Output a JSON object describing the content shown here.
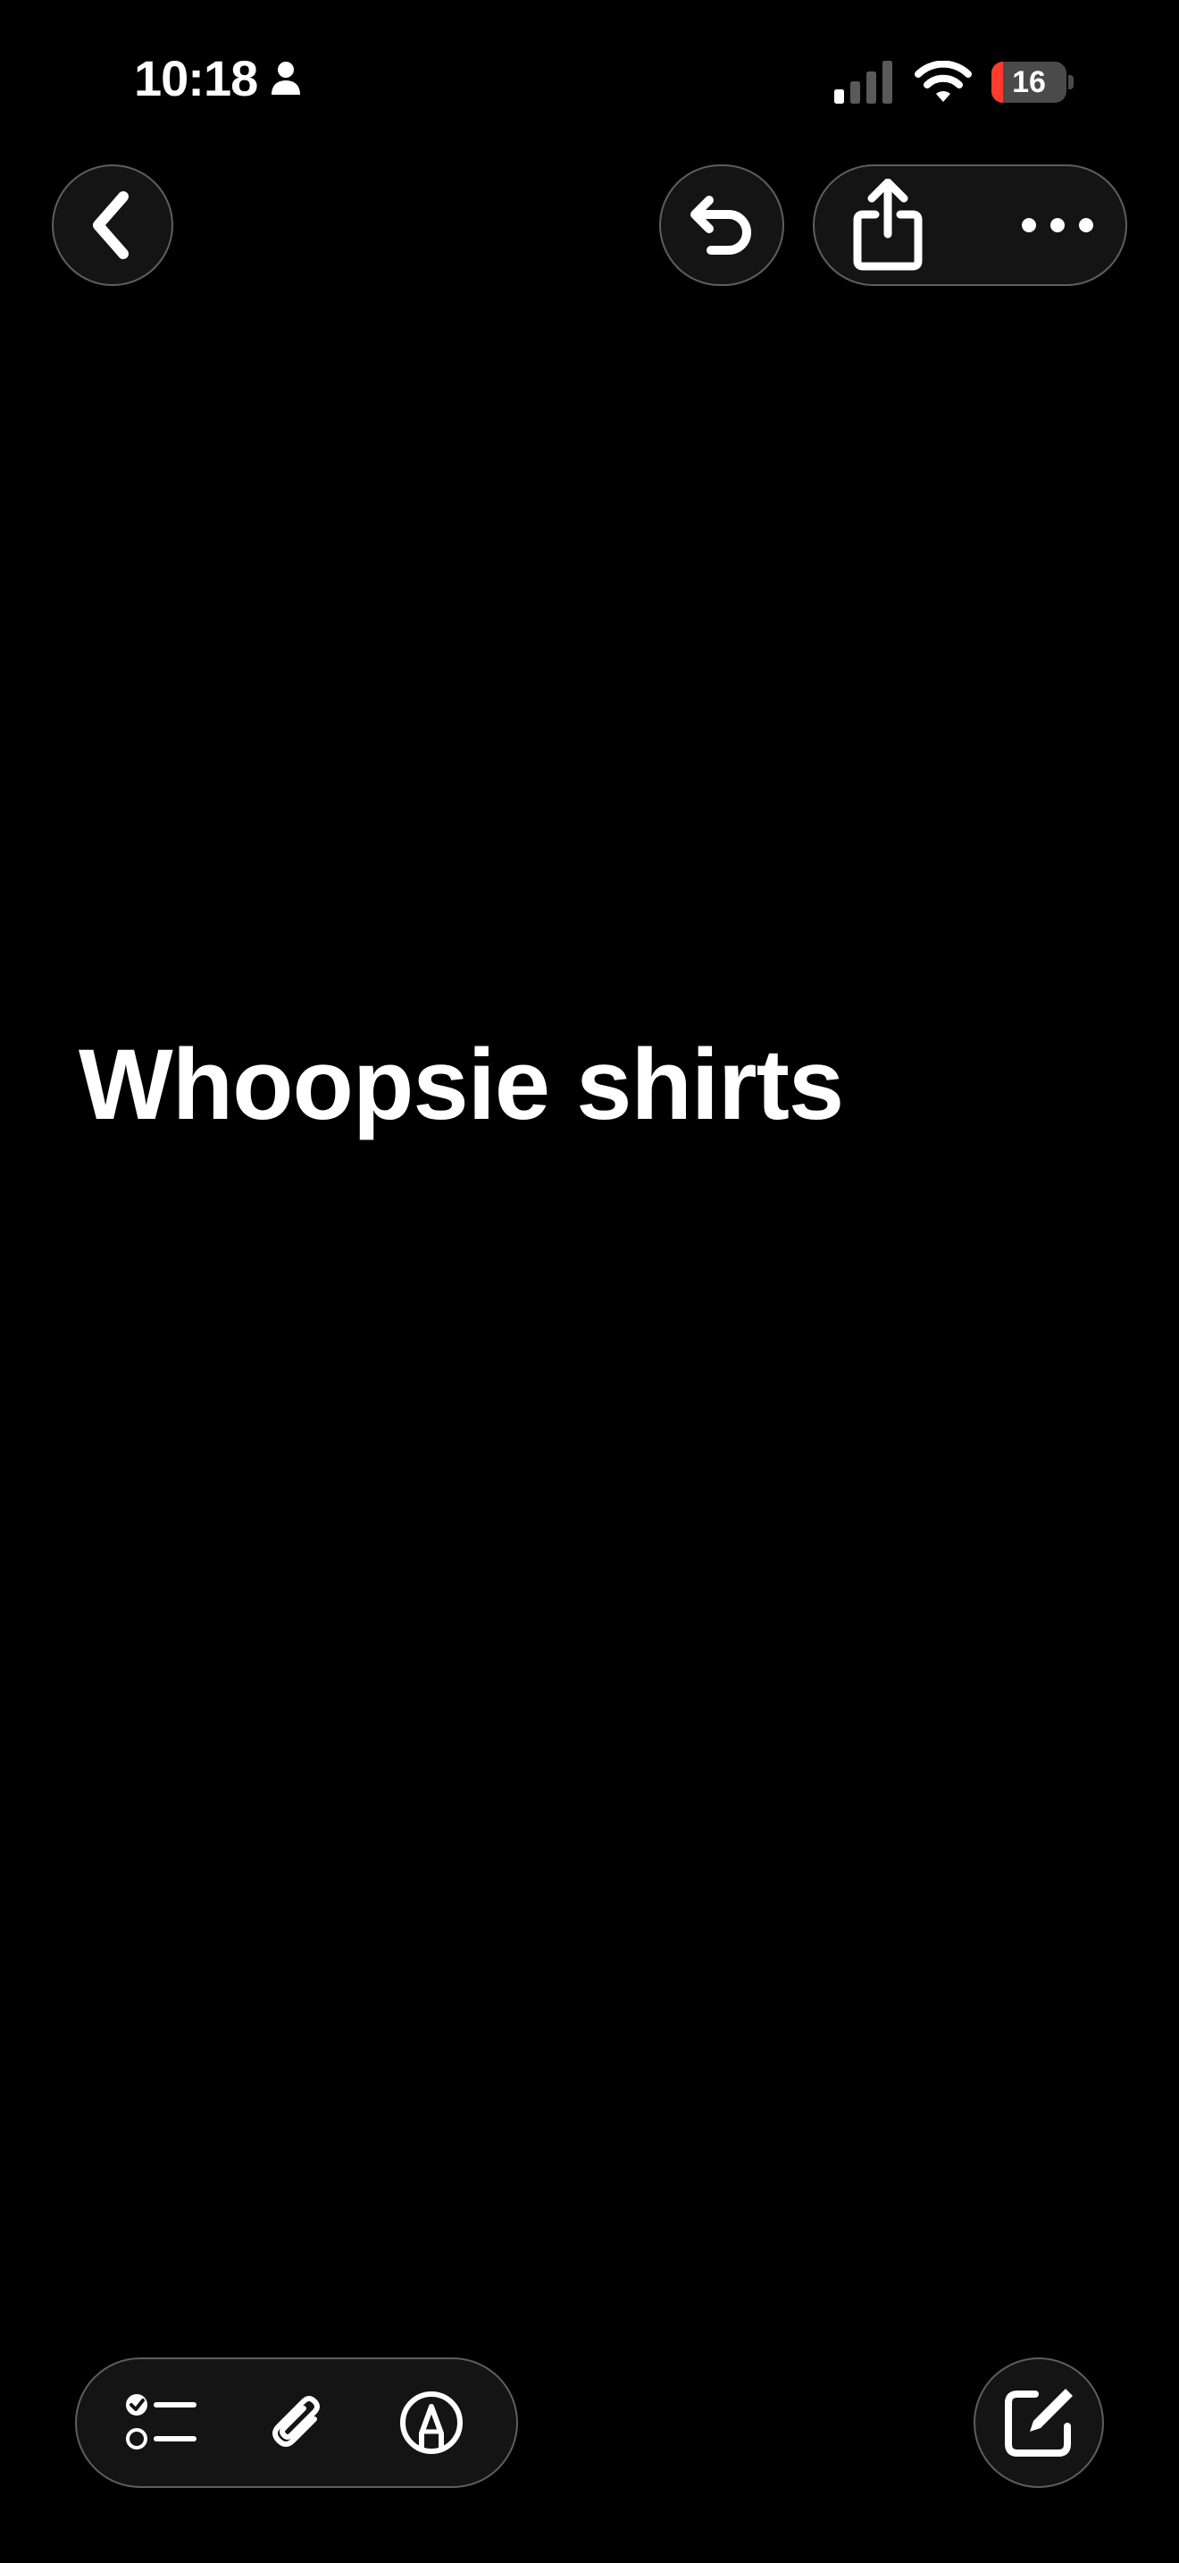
{
  "status_bar": {
    "time": "10:18",
    "battery_level": "16",
    "icons": [
      "person-icon",
      "cellular-signal-icon",
      "wifi-icon",
      "battery-icon"
    ]
  },
  "toolbar_top": {
    "icons": [
      "chevron-left-icon",
      "undo-icon",
      "share-icon",
      "ellipsis-icon"
    ]
  },
  "note": {
    "title": "Whoopsie shirts"
  },
  "toolbar_bottom": {
    "icons": [
      "checklist-icon",
      "paperclip-icon",
      "markup-pen-icon",
      "compose-icon"
    ]
  },
  "colors": {
    "background": "#000000",
    "text": "#ffffff",
    "button_fill": "#141414",
    "button_border": "#5e5e5e",
    "battery_low": "#ff3b30"
  }
}
